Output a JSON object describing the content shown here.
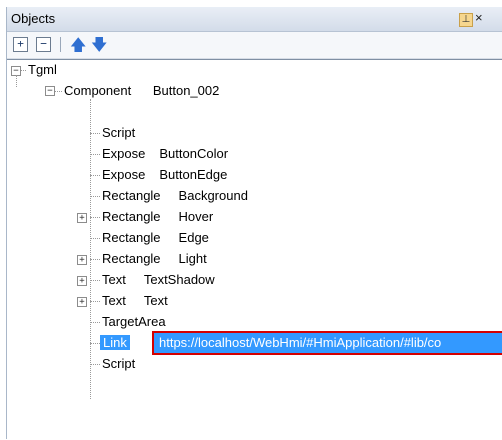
{
  "panel": {
    "title": "Objects"
  },
  "toolbar": {
    "expand_label": "+",
    "collapse_label": "−",
    "up_icon": "arrow-up-icon",
    "down_icon": "arrow-down-icon"
  },
  "tree": {
    "root": "Tgml",
    "component": {
      "type": "Component",
      "name": "Button_002"
    },
    "children": [
      {
        "type": "Script",
        "name": ""
      },
      {
        "type": "Expose",
        "name": "ButtonColor"
      },
      {
        "type": "Expose",
        "name": "ButtonEdge"
      },
      {
        "type": "Rectangle",
        "name": "Background"
      },
      {
        "type": "Rectangle",
        "name": "Hover"
      },
      {
        "type": "Rectangle",
        "name": "Edge"
      },
      {
        "type": "Rectangle",
        "name": "Light"
      },
      {
        "type": "Text",
        "name": "TextShadow"
      },
      {
        "type": "Text",
        "name": "Text"
      },
      {
        "type": "TargetArea",
        "name": ""
      },
      {
        "type": "Link",
        "name": "https://localhost/WebHmi/#HmiApplication/#lib/co"
      },
      {
        "type": "Script",
        "name": ""
      }
    ]
  },
  "colors": {
    "selection": "#3399ff",
    "highlight_border": "#d40000"
  }
}
